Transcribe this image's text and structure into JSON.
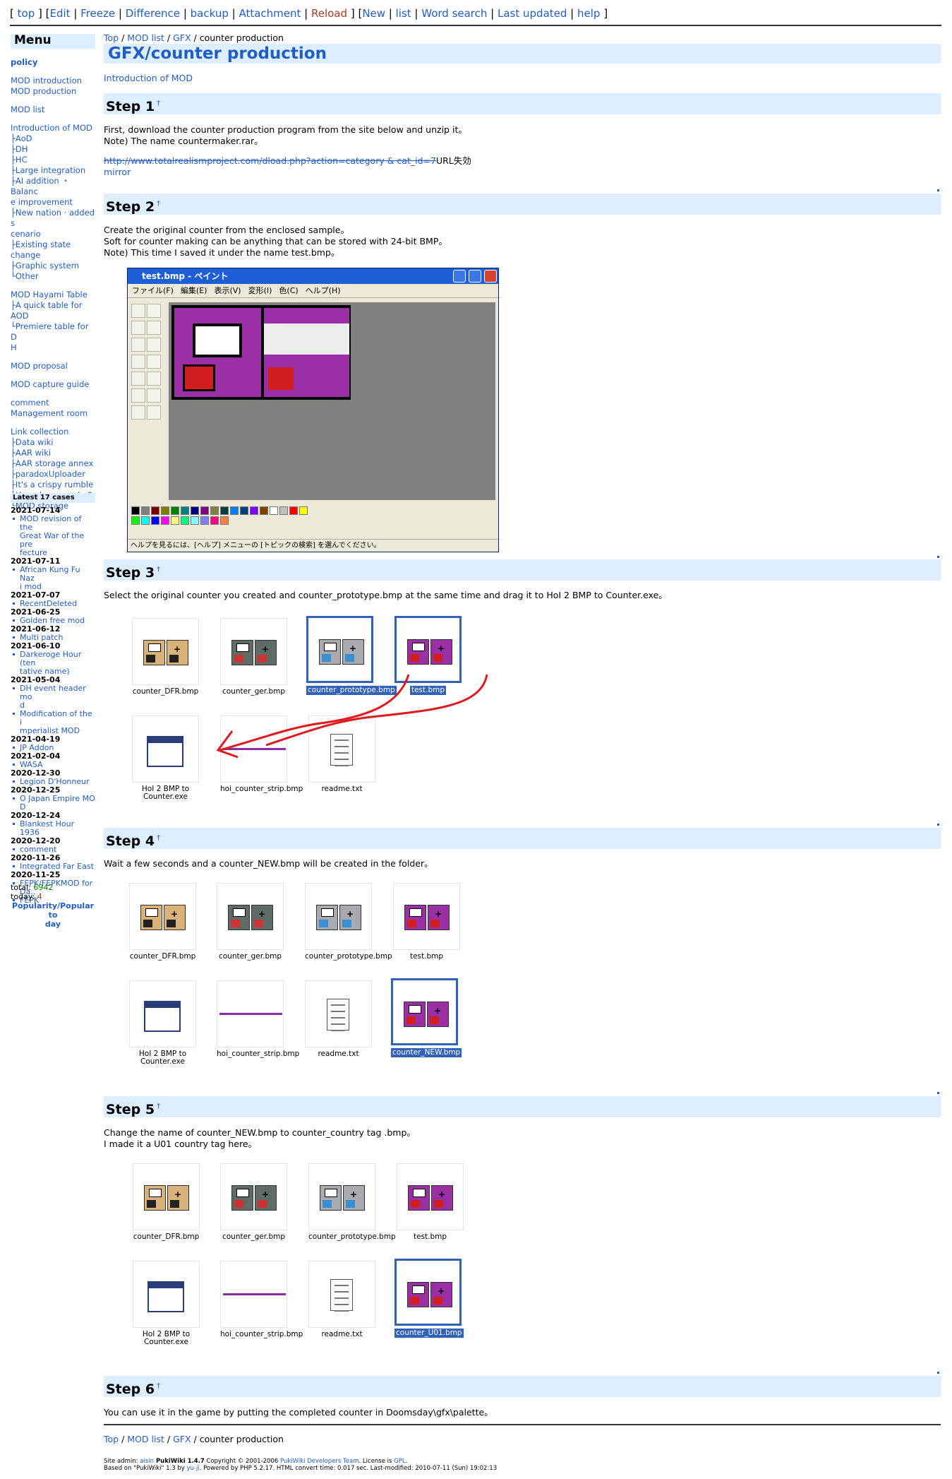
{
  "topnav": {
    "open1": "[",
    "top": "top",
    "close1": "]",
    "open2": "[",
    "edit": "Edit",
    "freeze": "Freeze",
    "diff": "Difference",
    "backup": "backup",
    "attach": "Attachment",
    "reload": "Reload",
    "close2": "]",
    "open3": "[",
    "new": "New",
    "list": "list",
    "search": "Word search",
    "updated": "Last updated",
    "help": "help",
    "close3": "]"
  },
  "menu": {
    "title": "Menu",
    "policy": "policy",
    "intro": "MOD introduction",
    "production": "MOD production",
    "modlist": "MOD list",
    "introof": "Introduction of MOD",
    "aod": "├AoD",
    "dh": "├DH",
    "hc": "├HC",
    "large": "├Large integration",
    "ai1": "├AI addition ・Balanc",
    "ai2": "e improvement",
    "nn1": "├New nation · added s",
    "nn2": "cenario",
    "existing": "├Existing state change",
    "graphic": "├Graphic system",
    "other": "└Other",
    "hayami": "MOD Hayami Table",
    "quick": "├A quick table for AOD",
    "premiere1": "└Premiere table for D",
    "premiere2": "H",
    "proposal": "MOD proposal",
    "capture": "MOD capture guide",
    "comment": "comment",
    "mgmt": "Management room",
    "links": "Link collection",
    "datawiki": "├Data wiki",
    "aarwiki": "├AAR wiki",
    "aarannex": "├AAR storage annex",
    "paradox": "├paradoxUploader",
    "crispy": "├It's a crispy rumble",
    "homebrew": "├Homebrew moda 2",
    "modstorage": "└MOD storage"
  },
  "recent": {
    "title": "Latest 17 cases",
    "items": [
      {
        "d": "2021-07-14",
        "t": [
          "MOD revision of the",
          "Great War of the pre",
          "fecture"
        ]
      },
      {
        "d": "2021-07-11",
        "t": [
          "African Kung Fu Naz",
          "i mod"
        ]
      },
      {
        "d": "2021-07-07",
        "t": [
          "RecentDeleted"
        ]
      },
      {
        "d": "2021-06-25",
        "t": [
          "Golden free mod"
        ]
      },
      {
        "d": "2021-06-12",
        "t": [
          "Multi patch"
        ]
      },
      {
        "d": "2021-06-10",
        "t": [
          "Darkeroge Hour (ten",
          "tative name)"
        ]
      },
      {
        "d": "2021-05-04",
        "t": [
          "DH event header mo",
          "d"
        ]
      },
      {
        "d": "",
        "t": [
          "Modification of the i",
          "mperialist MOD"
        ]
      },
      {
        "d": "2021-04-19",
        "t": [
          "JP Addon"
        ]
      },
      {
        "d": "2021-02-04",
        "t": [
          "WASA"
        ]
      },
      {
        "d": "2020-12-30",
        "t": [
          "Legion D'Honneur"
        ]
      },
      {
        "d": "2020-12-25",
        "t": [
          "O Japan Empire MO",
          "D"
        ]
      },
      {
        "d": "2020-12-24",
        "t": [
          "Blankest Hour 1936"
        ]
      },
      {
        "d": "2020-12-20",
        "t": [
          "comment"
        ]
      },
      {
        "d": "2020-11-26",
        "t": [
          "Integrated Far East"
        ]
      },
      {
        "d": "2020-11-25",
        "t": [
          "FEPK/FEPKMOD for",
          "Da.."
        ]
      },
      {
        "d": "",
        "t": [
          "FEPK"
        ]
      }
    ]
  },
  "counter": {
    "total_label": "total:",
    "total": "6942",
    "today_label": "today:",
    "today": "4",
    "popular1": "Popularity/Popular to",
    "popular2": "day"
  },
  "breadcrumb": {
    "top": "Top",
    "modlist": "MOD list",
    "gfx": "GFX",
    "sep": "/",
    "current": "counter production"
  },
  "title": "GFX/counter production",
  "introlink": "Introduction of MOD",
  "steps": {
    "s1": {
      "h": "Step 1",
      "l1": "First, download the counter production program from the site below and unzip it。",
      "l2": "Note) The name countermaker.rar。",
      "url": "http://www.totalrealismproject.com/dload.php?action=category & cat_id=7",
      "urlnote": "URL失効",
      "mirror": "mirror"
    },
    "s2": {
      "h": "Step 2",
      "l1": "Create the original counter from the enclosed sample。",
      "l2": "Soft for counter making can be anything that can be stored with 24-bit BMP。",
      "l3": "Note) This time I saved it under the name test.bmp。"
    },
    "s3": {
      "h": "Step 3",
      "l1": "Select the original counter you created and counter_prototype.bmp at the same time and drag it to HoI 2 BMP to Counter.exe。"
    },
    "s4": {
      "h": "Step 4",
      "l1": "Wait a few seconds and a counter_NEW.bmp will be created in the folder。"
    },
    "s5": {
      "h": "Step 5",
      "l1": "Change the name of counter_NEW.bmp to counter_country tag .bmp。",
      "l2": "I made it a U01 country tag here。"
    },
    "s6": {
      "h": "Step 6",
      "l1": "You can use it in the game by putting the completed counter in Doomsday\\gfx\\palette。"
    }
  },
  "files": {
    "dfr": "counter_DFR.bmp",
    "ger": "counter_ger.bmp",
    "proto": "counter_prototype.bmp",
    "test": "test.bmp",
    "exe1": "HoI 2 BMP to",
    "exe2": "Counter.exe",
    "strip": "hoi_counter_strip.bmp",
    "readme": "readme.txt",
    "new": "counter_NEW.bmp",
    "u01": "counter_U01.bmp"
  },
  "paint": {
    "title": "test.bmp - ペイント",
    "menu": [
      "ファイル(F)",
      "編集(E)",
      "表示(V)",
      "変形(I)",
      "色(C)",
      "ヘルプ(H)"
    ],
    "status": "ヘルプを見るには、[ヘルプ] メニューの [トピックの検索] を選んでください。"
  },
  "footer": {
    "l1a": "Site admin: ",
    "admin": "aisin",
    "l1b": " PukiWiki 1.4.7",
    "l1c": " Copyright © 2001-2006 ",
    "devs": "PukiWiki Developers Team",
    "l1d": ". License is ",
    "gpl": "GPL",
    "l1e": ".",
    "l2a": "Based on \"PukiWiki\" 1.3 by ",
    "yuji": "yu-ji",
    "l2b": ". Powered by PHP 5.2.17. HTML convert time: 0.017 sec. Last-modified: 2010-07-11 (Sun) 19:02:13"
  },
  "colors": {
    "accent": "#215dc6",
    "header_bg": "#ddeeff",
    "counter_purple": "#9b2fa6",
    "selection": "#3162b8",
    "arrow": "#e0191f"
  }
}
